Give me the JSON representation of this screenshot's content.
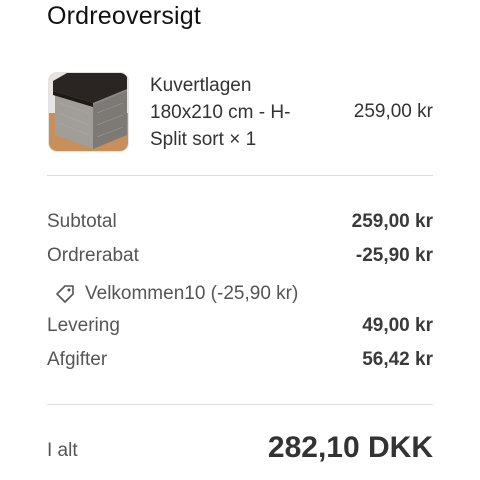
{
  "header": {
    "title": "Ordreoversigt"
  },
  "product": {
    "image_icon": "mattress-topper-product-image",
    "name": "Kuvertlagen 180x210 cm - H-Split sort × 1",
    "price": "259,00 kr"
  },
  "summary": {
    "subtotal_label": "Subtotal",
    "subtotal_value": "259,00 kr",
    "discount_label": "Ordrerabat",
    "discount_value": "-25,90 kr",
    "discount_code_icon": "tag-icon",
    "discount_code_text": "Velkommen10 (-25,90 kr)",
    "shipping_label": "Levering",
    "shipping_value": "49,00 kr",
    "taxes_label": "Afgifter",
    "taxes_value": "56,42 kr"
  },
  "total": {
    "label": "I alt",
    "value": "282,10 DKK"
  },
  "colors": {
    "text_dark": "#333333",
    "text_muted": "#555555",
    "divider": "#dcdcdc",
    "background": "#ffffff"
  }
}
